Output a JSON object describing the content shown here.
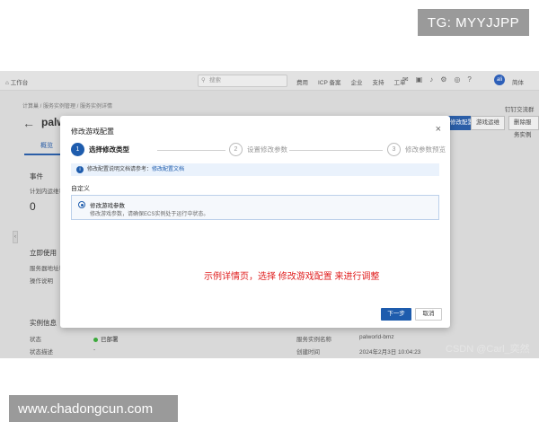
{
  "watermarks": {
    "tg": "TG: MYYJJPP",
    "site": "www.chadongcun.com",
    "csdn": "CSDN @Carl_奕然"
  },
  "topbar": {
    "home": "工作台",
    "search_placeholder": "搜索",
    "nav": [
      "费用",
      "ICP 备案",
      "企业",
      "支持",
      "工单"
    ],
    "lang": "简体",
    "avatar": "ali"
  },
  "breadcrumb": "计算巢 / 服务实例管理 / 服务实例详情",
  "page": {
    "title": "palw",
    "buttons": [
      "修改配置",
      "游戏运维",
      "删除服务实例"
    ],
    "ext_link": "钉钉交流群"
  },
  "tabs": {
    "overview": "概览"
  },
  "background": {
    "events_title": "事件",
    "events_sub": "计划内运维事件",
    "events_value": "0",
    "quick_use": "立即使用",
    "quick_lines": [
      "服务器地址和端口",
      "操作说明"
    ],
    "instance_info": "实例信息",
    "status_label": "状态",
    "status_value": "已部署",
    "status_desc_label": "状态描述",
    "status_desc_value": "-",
    "name_label": "服务实例名称",
    "name_value": "palworld-bmz",
    "created_label": "创建时间",
    "created_value": "2024年2月3日 10:04:23"
  },
  "modal": {
    "title": "修改游戏配置",
    "steps": [
      {
        "num": "1",
        "label": "选择修改类型"
      },
      {
        "num": "2",
        "label": "设置修改参数"
      },
      {
        "num": "3",
        "label": "修改参数预览"
      }
    ],
    "info_text": "修改配置说明文档请参考：",
    "info_link": "修改配置文档",
    "section_label": "自定义",
    "option_title": "修改游戏参数",
    "option_desc": "修改游戏参数，请确保ECS实例处于运行中状态。",
    "annotation": "示例详情页，选择 修改游戏配置 来进行调整",
    "next_button": "下一步",
    "cancel_button": "取消"
  }
}
